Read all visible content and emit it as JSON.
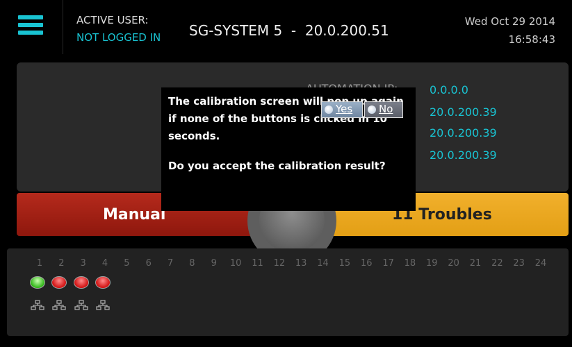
{
  "header": {
    "active_user_label": "ACTIVE USER:",
    "active_user_value": "NOT LOGGED IN",
    "system_title": "SG-SYSTEM 5  -  20.0.200.51",
    "date": "Wed Oct 29 2014",
    "time": "16:58:43",
    "menu_icon": "hamburger-menu-icon"
  },
  "main": {
    "automation_ip_label": "AUTOMATION IP:",
    "ips": [
      "0.0.0.0",
      "20.0.200.39",
      "20.0.200.39",
      "20.0.200.39"
    ],
    "manual_label": "Manual",
    "troubles_label": "11 Troubles"
  },
  "channels": {
    "numbers": [
      "1",
      "2",
      "3",
      "4",
      "5",
      "6",
      "7",
      "8",
      "9",
      "10",
      "11",
      "12",
      "13",
      "14",
      "15",
      "16",
      "17",
      "18",
      "19",
      "20",
      "21",
      "22",
      "23",
      "24"
    ],
    "status": [
      "green",
      "red",
      "red",
      "red"
    ],
    "status_icon": "network-icon"
  },
  "dialog": {
    "message": "The calibration screen will pop up again if none of the buttons is clicked in 10 seconds.",
    "question": "Do you accept the calibration result?",
    "yes_label": "Yes",
    "no_label": "No"
  },
  "colors": {
    "accent": "#19c3d2",
    "manual": "#a3221a",
    "troubles": "#eba521",
    "ok": "#3cc41c",
    "alarm": "#e21515"
  }
}
